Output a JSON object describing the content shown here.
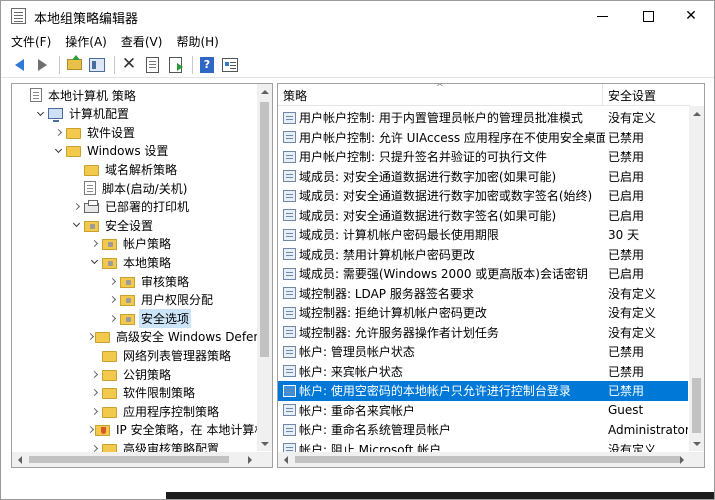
{
  "window": {
    "title": "本地组策略编辑器",
    "icon": "gpedit-icon"
  },
  "menu": [
    "文件(F)",
    "操作(A)",
    "查看(V)",
    "帮助(H)"
  ],
  "toolbar": [
    "back-arrow-icon",
    "forward-arrow-icon",
    "folder-up-icon",
    "show-tree-icon",
    "delete-icon",
    "properties-doc-icon",
    "export-list-icon",
    "help-icon",
    "properties-icon"
  ],
  "tree": [
    {
      "label": "本地计算机 策略",
      "level": 0,
      "toggle": "none",
      "icon": "policy-icon"
    },
    {
      "label": "计算机配置",
      "level": 1,
      "toggle": "expanded",
      "icon": "computer-icon"
    },
    {
      "label": "软件设置",
      "level": 2,
      "toggle": "collapsed",
      "icon": "folder-icon"
    },
    {
      "label": "Windows 设置",
      "level": 2,
      "toggle": "expanded",
      "icon": "folder-icon"
    },
    {
      "label": "域名解析策略",
      "level": 3,
      "toggle": "none",
      "icon": "folder-icon"
    },
    {
      "label": "脚本(启动/关机)",
      "level": 3,
      "toggle": "none",
      "icon": "script-icon"
    },
    {
      "label": "已部署的打印机",
      "level": 3,
      "toggle": "collapsed",
      "icon": "printer-icon"
    },
    {
      "label": "安全设置",
      "level": 3,
      "toggle": "expanded",
      "icon": "security-folder-icon"
    },
    {
      "label": "帐户策略",
      "level": 4,
      "toggle": "collapsed",
      "icon": "security-folder-icon"
    },
    {
      "label": "本地策略",
      "level": 4,
      "toggle": "expanded",
      "icon": "security-folder-icon"
    },
    {
      "label": "审核策略",
      "level": 5,
      "toggle": "collapsed",
      "icon": "security-folder-icon"
    },
    {
      "label": "用户权限分配",
      "level": 5,
      "toggle": "collapsed",
      "icon": "security-folder-icon"
    },
    {
      "label": "安全选项",
      "level": 5,
      "toggle": "collapsed",
      "icon": "security-folder-icon",
      "selected": true
    },
    {
      "label": "高级安全 Windows Defende",
      "level": 4,
      "toggle": "collapsed",
      "icon": "folder-icon"
    },
    {
      "label": "网络列表管理器策略",
      "level": 4,
      "toggle": "none",
      "icon": "folder-icon"
    },
    {
      "label": "公钥策略",
      "level": 4,
      "toggle": "collapsed",
      "icon": "folder-icon"
    },
    {
      "label": "软件限制策略",
      "level": 4,
      "toggle": "collapsed",
      "icon": "folder-icon"
    },
    {
      "label": "应用程序控制策略",
      "level": 4,
      "toggle": "collapsed",
      "icon": "folder-icon"
    },
    {
      "label": "IP 安全策略，在 本地计算机",
      "level": 4,
      "toggle": "collapsed",
      "icon": "ip-security-icon"
    },
    {
      "label": "高级审核策略配置",
      "level": 4,
      "toggle": "collapsed",
      "icon": "folder-icon"
    }
  ],
  "list": {
    "columns": [
      "策略",
      "安全设置"
    ],
    "rows": [
      {
        "policy": "用户帐户控制: 用于内置管理员帐户的管理员批准模式",
        "setting": "没有定义"
      },
      {
        "policy": "用户帐户控制: 允许 UIAccess 应用程序在不使用安全桌面…",
        "setting": "已禁用"
      },
      {
        "policy": "用户帐户控制: 只提升签名并验证的可执行文件",
        "setting": "已禁用"
      },
      {
        "policy": "域成员: 对安全通道数据进行数字加密(如果可能)",
        "setting": "已启用"
      },
      {
        "policy": "域成员: 对安全通道数据进行数字加密或数字签名(始终)",
        "setting": "已启用"
      },
      {
        "policy": "域成员: 对安全通道数据进行数字签名(如果可能)",
        "setting": "已启用"
      },
      {
        "policy": "域成员: 计算机帐户密码最长使用期限",
        "setting": "30 天"
      },
      {
        "policy": "域成员: 禁用计算机帐户密码更改",
        "setting": "已禁用"
      },
      {
        "policy": "域成员: 需要强(Windows 2000 或更高版本)会话密钥",
        "setting": "已启用"
      },
      {
        "policy": "域控制器: LDAP 服务器签名要求",
        "setting": "没有定义"
      },
      {
        "policy": "域控制器: 拒绝计算机帐户密码更改",
        "setting": "没有定义"
      },
      {
        "policy": "域控制器: 允许服务器操作者计划任务",
        "setting": "没有定义"
      },
      {
        "policy": "帐户: 管理员帐户状态",
        "setting": "已禁用"
      },
      {
        "policy": "帐户: 来宾帐户状态",
        "setting": "已禁用"
      },
      {
        "policy": "帐户: 使用空密码的本地帐户只允许进行控制台登录",
        "setting": "已禁用",
        "selected": true
      },
      {
        "policy": "帐户: 重命名来宾帐户",
        "setting": "Guest"
      },
      {
        "policy": "帐户: 重命名系统管理员帐户",
        "setting": "Administrator"
      },
      {
        "policy": "帐户: 阻止 Microsoft 帐户",
        "setting": "没有定义"
      }
    ]
  },
  "colors": {
    "selection": "#0078d7",
    "tree_selection": "#cce4f7",
    "folder": "#f2c94c"
  }
}
